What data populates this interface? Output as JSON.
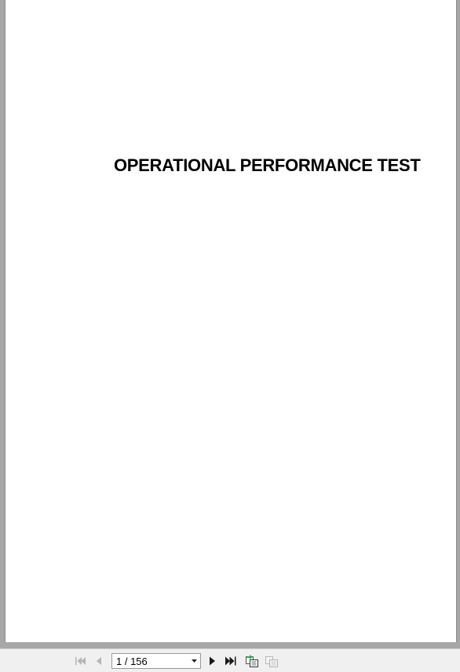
{
  "document": {
    "title": "OPERATIONAL PERFORMANCE TEST"
  },
  "toolbar": {
    "page_indicator": "1 / 156",
    "first_page_icon": "first-page-icon",
    "prev_page_icon": "previous-page-icon",
    "next_page_icon": "next-page-icon",
    "last_page_icon": "last-page-icon",
    "go_back_icon": "go-back-icon",
    "go_forward_icon": "go-forward-icon"
  }
}
